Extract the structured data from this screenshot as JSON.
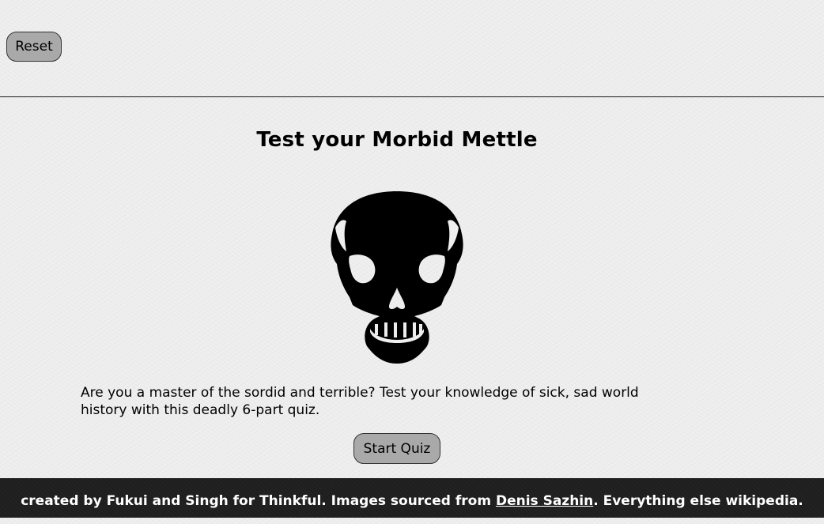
{
  "header": {
    "reset_label": "Reset"
  },
  "main": {
    "title": "Test your Morbid Mettle",
    "intro": "Are you a master of the sordid and terrible? Test your knowledge of sick, sad world history with this deadly 6-part quiz.",
    "start_label": "Start Quiz",
    "image_icon": "skull-icon"
  },
  "footer": {
    "text_before": "created by Fukui and Singh for Thinkful. Images sourced from ",
    "link_label": "Denis Sazhin",
    "text_after": ". Everything else wikipedia."
  },
  "colors": {
    "background": "#efefef",
    "button": "#a9a9a9",
    "footer": "#1f1f1f",
    "footer_text": "#ffffff"
  }
}
